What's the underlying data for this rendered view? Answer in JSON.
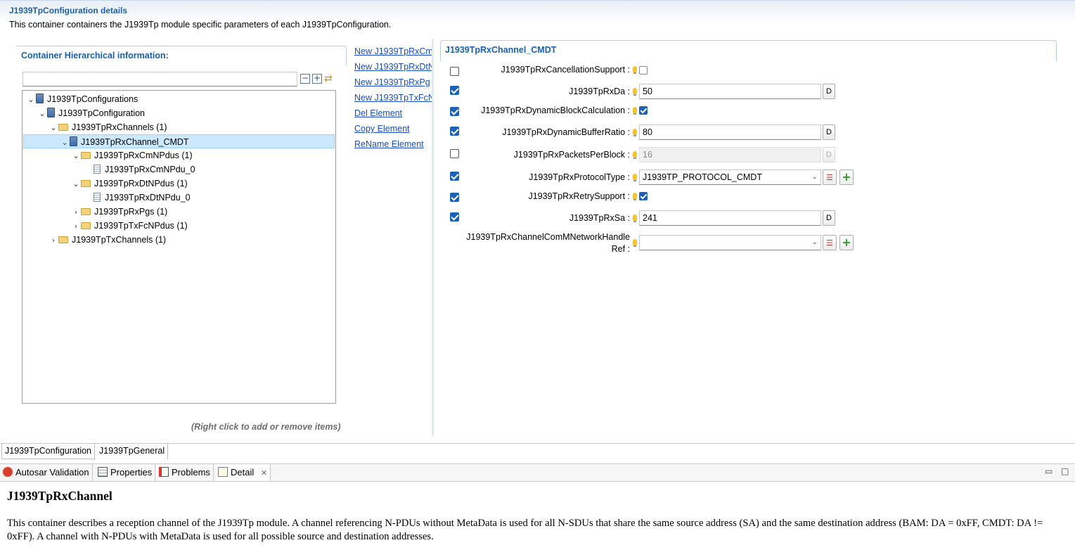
{
  "header": {
    "title": "J1939TpConfiguration details",
    "description": "This container containers the J1939Tp module specific parameters of each J1939TpConfiguration."
  },
  "hierarchy": {
    "title": "Container Hierarchical information:",
    "filter_value": "",
    "hint": "(Right click to add or remove items)",
    "tree": [
      {
        "label": "J1939TpConfigurations",
        "expanded": true,
        "icon": "config-icon"
      },
      {
        "label": "J1939TpConfiguration",
        "expanded": true,
        "icon": "config-icon"
      },
      {
        "label": "J1939TpRxChannels (1)",
        "expanded": true,
        "icon": "folder-icon"
      },
      {
        "label": "J1939TpRxChannel_CMDT",
        "expanded": true,
        "icon": "config-icon",
        "selected": true
      },
      {
        "label": "J1939TpRxCmNPdus (1)",
        "expanded": true,
        "icon": "folder-icon"
      },
      {
        "label": "J1939TpRxCmNPdu_0",
        "icon": "document-icon"
      },
      {
        "label": "J1939TpRxDtNPdus (1)",
        "expanded": true,
        "icon": "folder-icon"
      },
      {
        "label": "J1939TpRxDtNPdu_0",
        "icon": "document-icon"
      },
      {
        "label": "J1939TpRxPgs (1)",
        "expanded": false,
        "icon": "folder-icon"
      },
      {
        "label": "J1939TpTxFcNPdus (1)",
        "expanded": false,
        "icon": "folder-icon"
      },
      {
        "label": "J1939TpTxChannels (1)",
        "expanded": false,
        "icon": "folder-icon"
      }
    ]
  },
  "actions": [
    "New J1939TpRxCm",
    "New J1939TpRxDtN",
    "New J1939TpRxPg",
    "New J1939TpTxFcN",
    "Del Element",
    "Copy Element",
    "ReName Element"
  ],
  "details": {
    "title": "J1939TpRxChannel_CMDT",
    "params": [
      {
        "label": "J1939TpRxCancellationSupport :",
        "enabled": false,
        "value_checked": false
      },
      {
        "label": "J1939TpRxDa :",
        "enabled": true,
        "value": "50",
        "btn": "D"
      },
      {
        "label": "J1939TpRxDynamicBlockCalculation :",
        "enabled": true,
        "value_checked": true
      },
      {
        "label": "J1939TpRxDynamicBufferRatio :",
        "enabled": true,
        "value": "80",
        "btn": "D"
      },
      {
        "label": "J1939TpRxPacketsPerBlock :",
        "enabled": false,
        "value": "16",
        "btn": "D"
      },
      {
        "label": "J1939TpRxProtocolType :",
        "enabled": true,
        "value": "J1939TP_PROTOCOL_CMDT"
      },
      {
        "label": "J1939TpRxRetrySupport :",
        "enabled": true,
        "value_checked": true
      },
      {
        "label": "J1939TpRxSa :",
        "enabled": true,
        "value": "241",
        "btn": "D"
      },
      {
        "label_line1": "J1939TpRxChannelComMNetworkHandle",
        "label_line2": "Ref :",
        "value": ""
      }
    ]
  },
  "editor_tabs": [
    "J1939TpConfiguration",
    "J1939TpGeneral"
  ],
  "views": [
    "Autosar Validation",
    "Properties",
    "Problems",
    "Detail"
  ],
  "detail_view": {
    "title": "J1939TpRxChannel",
    "description": "This container describes a reception channel of the J1939Tp module. A channel referencing N-PDUs without MetaData is used for all N-SDUs that share the same source address (SA) and the same destination address (BAM: DA = 0xFF, CMDT: DA != 0xFF). A channel with N-PDUs with MetaData is used for all possible source and destination addresses."
  }
}
